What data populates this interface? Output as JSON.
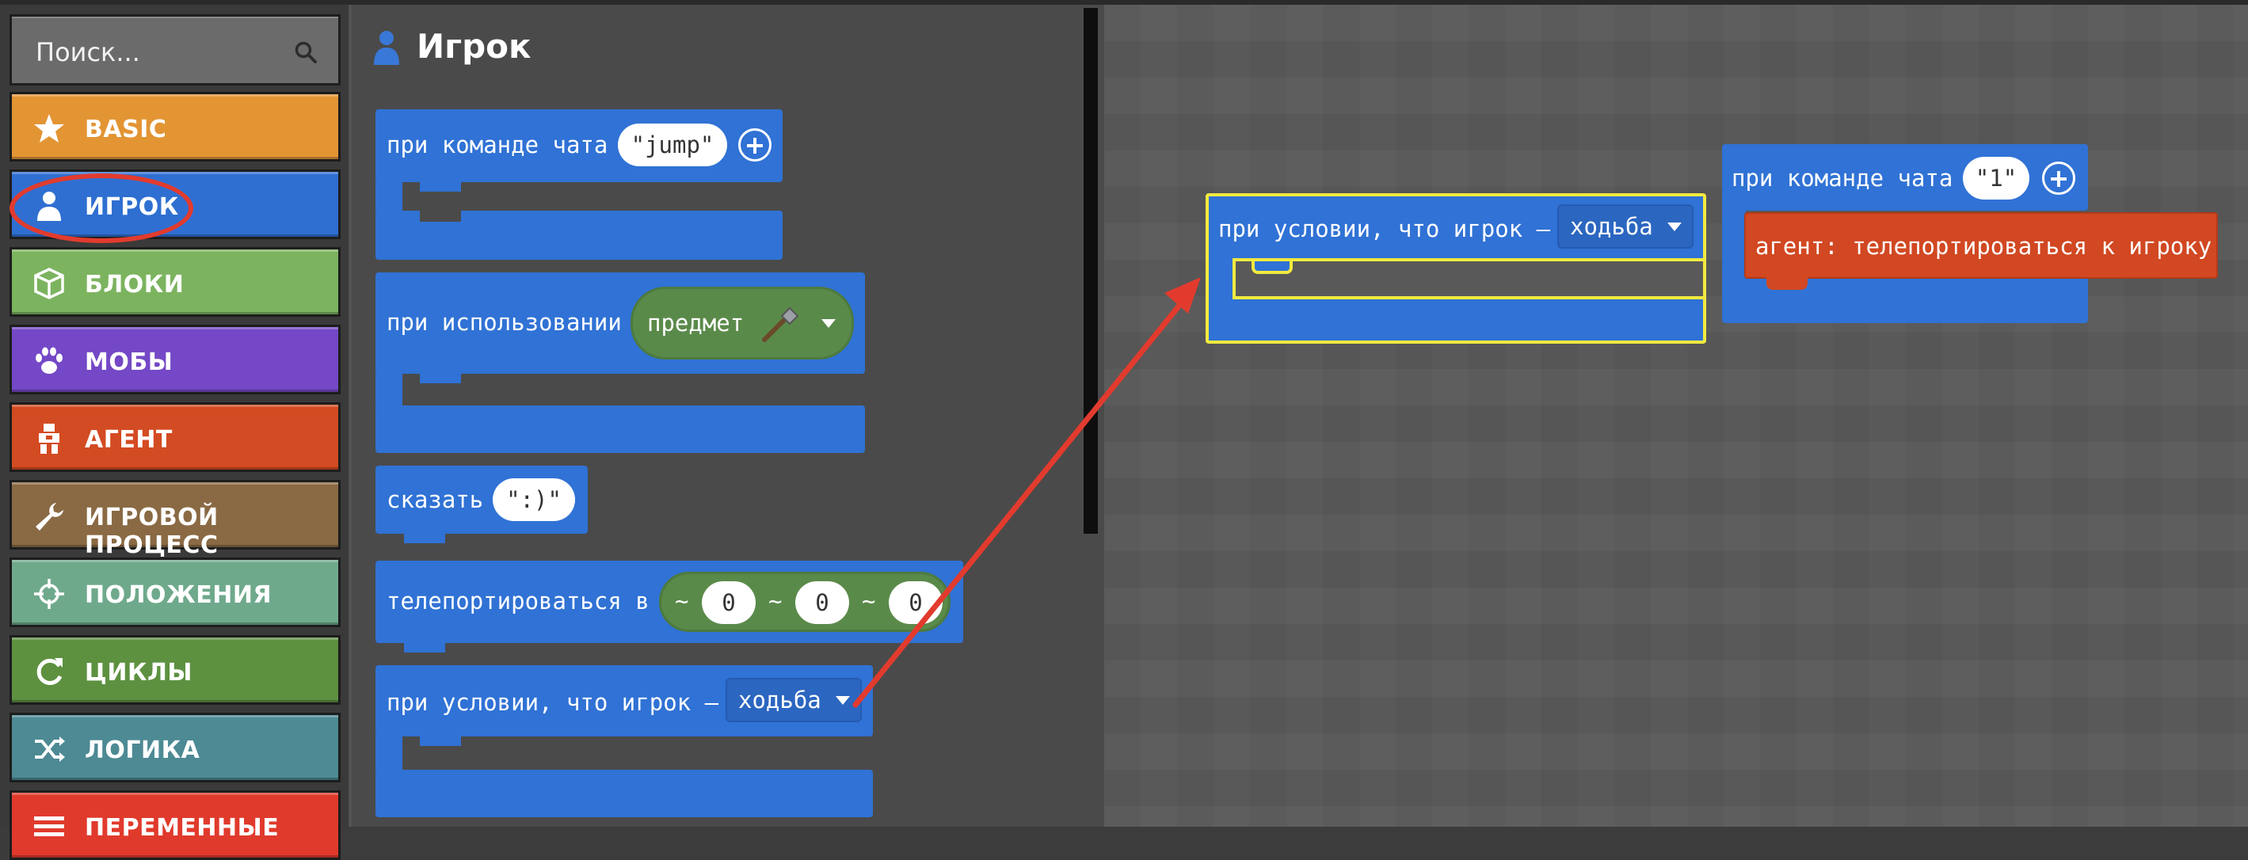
{
  "search": {
    "placeholder": "Поиск..."
  },
  "categories": [
    {
      "label": "BASIC",
      "color": "#e39534",
      "icon": "star-icon"
    },
    {
      "label": "ИГРОК",
      "color": "#2f6fd1",
      "icon": "person-icon"
    },
    {
      "label": "БЛОКИ",
      "color": "#7cb35f",
      "icon": "cube-icon"
    },
    {
      "label": "МОБЫ",
      "color": "#7448c6",
      "icon": "paw-icon"
    },
    {
      "label": "АГЕНТ",
      "color": "#d34b22",
      "icon": "agent-icon"
    },
    {
      "label": "ИГРОВОЙ ПРОЦЕСС",
      "color": "#8a6a44",
      "icon": "wrench-icon"
    },
    {
      "label": "ПОЛОЖЕНИЯ",
      "color": "#6fa98c",
      "icon": "crosshair-icon"
    },
    {
      "label": "ЦИКЛЫ",
      "color": "#5d9140",
      "icon": "loop-icon"
    },
    {
      "label": "ЛОГИКА",
      "color": "#4d8a94",
      "icon": "shuffle-icon"
    },
    {
      "label": "ПЕРЕМЕННЫЕ",
      "color": "#e03a2c",
      "icon": "list-icon"
    }
  ],
  "flyout": {
    "title": "Игрок",
    "blocks": {
      "chat_command": {
        "label": "при команде чата",
        "value": "\"jump\""
      },
      "on_use": {
        "label": "при использовании",
        "item": "предмет"
      },
      "say": {
        "label": "сказать",
        "value": "\":)\""
      },
      "teleport": {
        "label": "телепортироваться в",
        "tilde": "~",
        "x": "0",
        "y": "0",
        "z": "0"
      },
      "condition": {
        "label": "при условии, что игрок –",
        "state": "ходьба"
      }
    }
  },
  "workspace": {
    "condition_block": {
      "label": "при условии, что игрок –",
      "state": "ходьба"
    },
    "chat_block": {
      "label": "при команде чата",
      "value": "\"1\""
    },
    "agent_block": {
      "label": "агент: телепортироваться к игроку"
    }
  },
  "colors": {
    "player": "#3072d5",
    "agent": "#d14822",
    "highlight": "#f2ea3e",
    "arrow": "#e23b2e"
  }
}
